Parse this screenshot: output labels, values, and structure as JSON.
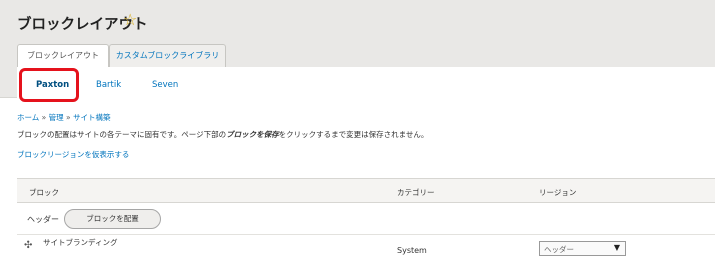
{
  "page": {
    "title": "ブロックレイアウト"
  },
  "primary_tabs": [
    {
      "label": "ブロックレイアウト",
      "active": true
    },
    {
      "label": "カスタムブロックライブラリ",
      "active": false
    }
  ],
  "secondary_tabs": [
    {
      "label": "Paxton",
      "active": true
    },
    {
      "label": "Bartik",
      "active": false
    },
    {
      "label": "Seven",
      "active": false
    }
  ],
  "breadcrumb": {
    "items": [
      "ホーム",
      "管理",
      "サイト構築"
    ],
    "separator": "»"
  },
  "description": {
    "before": "ブロックの配置はサイトの各テーマに固有です。ページ下部の",
    "emphasis": "ブロックを保存",
    "after": "をクリックするまで変更は保存されません。"
  },
  "demo_link": "ブロックリージョンを仮表示する",
  "table": {
    "headers": [
      "ブロック",
      "カテゴリー",
      "リージョン"
    ],
    "region_row": {
      "label": "ヘッダー",
      "button": "ブロックを配置"
    },
    "rows": [
      {
        "block": "サイトブランディング",
        "category": "System",
        "region": "ヘッダー"
      }
    ]
  },
  "icons": {
    "favorite": "star-icon",
    "drag": "drag-handle-icon",
    "dropdown": "chevron-down-icon"
  },
  "colors": {
    "link": "#0074bd",
    "highlight": "#e5121c",
    "star": "#d8ae1e",
    "header_bg": "#e9e8e6"
  }
}
